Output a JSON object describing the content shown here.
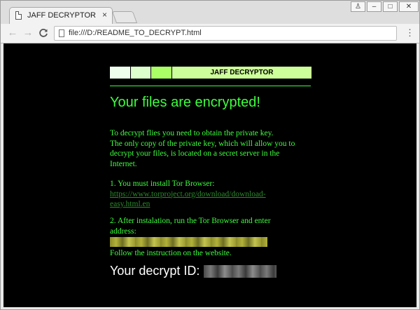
{
  "browser": {
    "tab_title": "JAFF DECRYPTOR",
    "tab_close": "×",
    "url": "file:///D:/README_TO_DECRYPT.html",
    "nav": {
      "back": "←",
      "forward": "→",
      "reload": "C"
    },
    "menu": "⋮",
    "window_controls": {
      "user": "♙",
      "minimize": "–",
      "maximize": "□",
      "close": "✕"
    }
  },
  "page": {
    "banner_title": "JAFF DECRYPTOR",
    "headline": "Your files are encrypted!",
    "intro": [
      "To decrypt flies you need to obtain the private key.",
      "The only copy of the private key, which will allow you to",
      "decrypt your files, is located on a secret server in the",
      "Internet."
    ],
    "step1_text": "1. You must install Tor Browser:",
    "step1_link_line1": "https://www.torproject.org/download/download-",
    "step1_link_line2": "easy.html.en",
    "step2_text_line1": "2. After instalation, run the Tor Browser and enter",
    "step2_text_line2": "address:",
    "follow_text": "Follow the instruction on the website.",
    "decrypt_id_label": "Your decrypt ID:"
  },
  "colors": {
    "page_background": "#000000",
    "text_green": "#3cff3c",
    "banner_green": "#ccff99"
  }
}
